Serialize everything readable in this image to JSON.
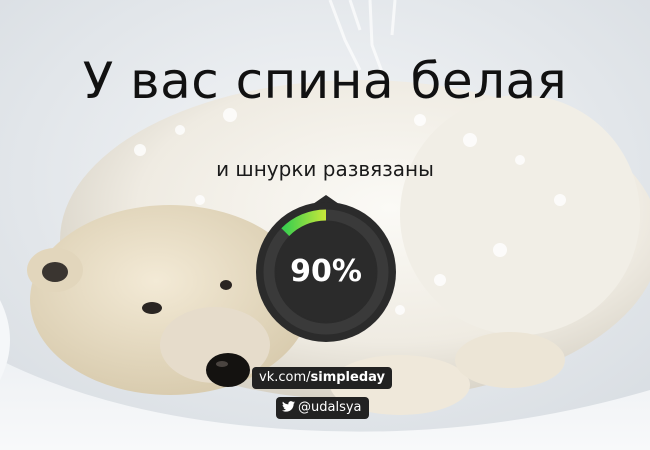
{
  "headline": "У вас спина белая",
  "subheadline": "и шнурки развязаны",
  "progress": {
    "value": 0.9,
    "label": "90%",
    "colors": {
      "track": "#2b2b2b",
      "segment_start": "#3ccf4e",
      "segment_end": "#c9e83a",
      "ring_bg": "#3a3a3a"
    }
  },
  "credits": {
    "site_domain": "vk.com/",
    "site_path": "simpleday",
    "twitter_handle": "@udalsya",
    "twitter_icon": "twitter-bird-icon"
  },
  "background": {
    "subject": "polar-bear-in-snow",
    "colors": {
      "snow": "#eef1f4",
      "fur": "#f3efe6",
      "shadow": "#c9ced4"
    }
  }
}
